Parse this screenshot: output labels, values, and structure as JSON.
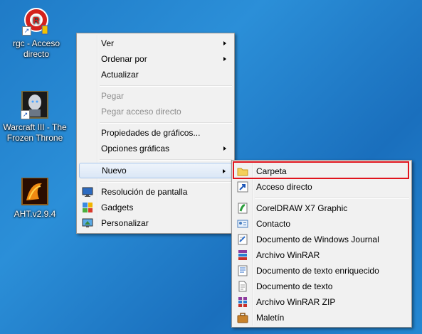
{
  "desktop": {
    "icons": [
      {
        "label_line1": "rgc - Acceso",
        "label_line2": "directo",
        "icon": "rgc-app-icon"
      },
      {
        "label_line1": "Warcraft III - The",
        "label_line2": "Frozen Throne",
        "icon": "warcraft-icon"
      },
      {
        "label_line1": "AHT.v2.9.4",
        "label_line2": "",
        "icon": "aht-map-icon"
      }
    ]
  },
  "context_menu": {
    "items": [
      {
        "label": "Ver"
      },
      {
        "label": "Ordenar por"
      },
      {
        "label": "Actualizar"
      },
      {
        "label": "Pegar"
      },
      {
        "label": "Pegar acceso directo"
      },
      {
        "label": "Propiedades de gráficos..."
      },
      {
        "label": "Opciones gráficas"
      },
      {
        "label": "Nuevo"
      },
      {
        "label": "Resolución de pantalla"
      },
      {
        "label": "Gadgets"
      },
      {
        "label": "Personalizar"
      }
    ]
  },
  "submenu_nuevo": {
    "items": [
      {
        "label": "Carpeta",
        "icon": "folder-icon"
      },
      {
        "label": "Acceso directo",
        "icon": "shortcut-icon"
      },
      {
        "label": "CorelDRAW X7 Graphic",
        "icon": "coreldraw-icon"
      },
      {
        "label": "Contacto",
        "icon": "contact-icon"
      },
      {
        "label": "Documento de Windows Journal",
        "icon": "journal-icon"
      },
      {
        "label": "Archivo WinRAR",
        "icon": "winrar-icon"
      },
      {
        "label": "Documento de texto enriquecido",
        "icon": "wordpad-icon"
      },
      {
        "label": "Documento de texto",
        "icon": "text-file-icon"
      },
      {
        "label": "Archivo WinRAR ZIP",
        "icon": "winrar-zip-icon"
      },
      {
        "label": "Maletín",
        "icon": "briefcase-icon"
      }
    ]
  },
  "colors": {
    "highlight_border": "#e0141d",
    "desktop_blue": "#1f7bc7"
  }
}
